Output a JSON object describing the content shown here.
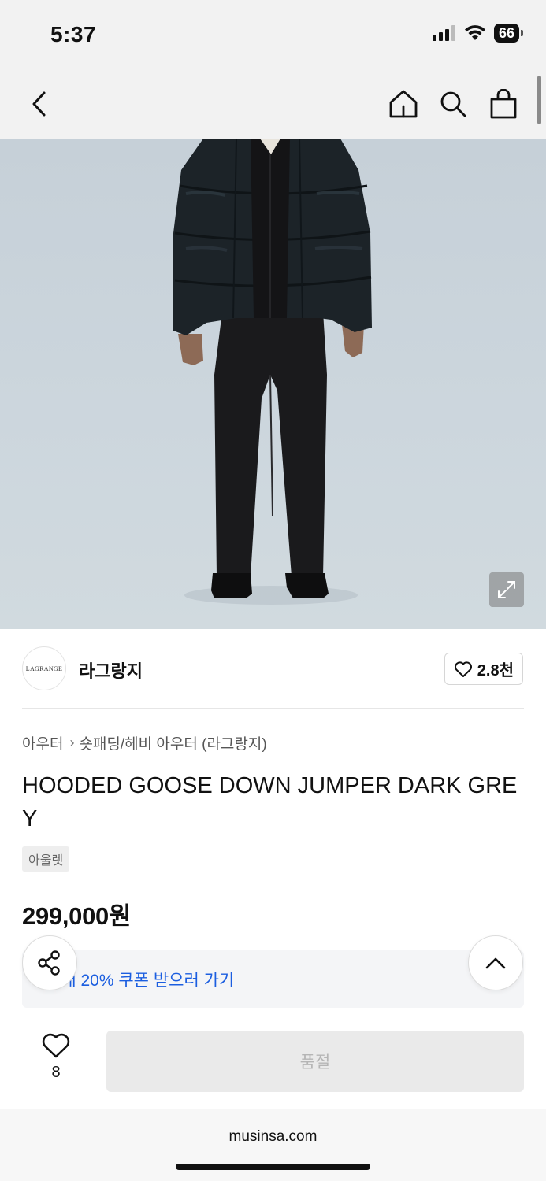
{
  "status_bar": {
    "time": "5:37",
    "battery": "66",
    "icons": [
      "signal-icon",
      "wifi-icon",
      "battery-icon"
    ]
  },
  "header": {
    "icons": [
      "back-chevron-icon",
      "home-icon",
      "search-icon",
      "shopping-bag-icon"
    ]
  },
  "hero": {
    "icons": [
      "expand-icon"
    ]
  },
  "brand": {
    "logo_text": "LAGRANGE",
    "name": "라그랑지",
    "like_count": "2.8천",
    "icons": [
      "heart-outline-icon"
    ]
  },
  "product": {
    "breadcrumb": [
      "아우터",
      "숏패딩/헤비 아우터 (라그랑지)"
    ],
    "title": "HOODED GOOSE DOWN JUMPER DARK GREY",
    "tag": "아울렛",
    "price": "299,000원"
  },
  "coupon": {
    "text": "구매 20% 쿠폰 받으러 가기"
  },
  "floating": {
    "icons": [
      "share-icon",
      "chevron-up-icon"
    ]
  },
  "action_bar": {
    "wish_count": "8",
    "soldout_label": "품절"
  },
  "browser": {
    "url": "musinsa.com"
  },
  "colors": {
    "header_bg": "#f2f2f2",
    "coupon_text": "#1b5ee0",
    "soldout_bg": "#eaeaea",
    "soldout_text": "#b5b5b5",
    "hero_bg": "#ccd6dd",
    "jacket": "#1c2328"
  }
}
